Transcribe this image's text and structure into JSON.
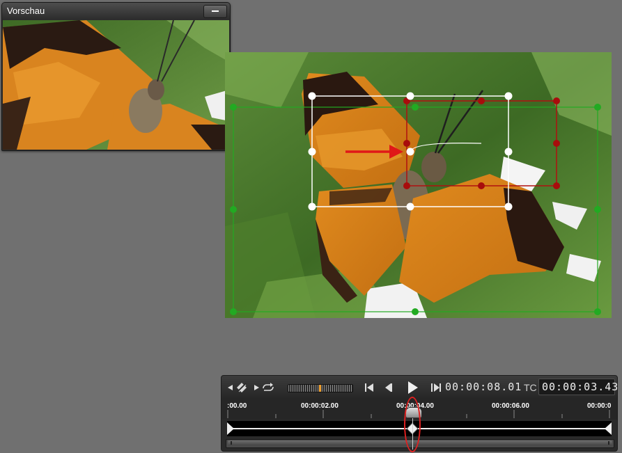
{
  "preview_window": {
    "title": "Vorschau",
    "minimize_icon": "minus-icon"
  },
  "canvas": {
    "image_subject": "butterfly-photo",
    "frames": {
      "start_frame_color": "#ffffff",
      "end_frame_color": "#c01010",
      "outer_frame_color": "#22aa22"
    },
    "motion_arrow_color": "#e01818",
    "arrow_icon": "motion-arrow-icon"
  },
  "timeline": {
    "duration": "00:00:08.01",
    "tc_label": "TC",
    "timecode": "00:00:03.43",
    "ruler_labels": [
      ":00.00",
      "00:00:02.00",
      "00:00:04.00",
      "00:00:06.00",
      "00:00:0"
    ],
    "icons": [
      "prev-frame-icon",
      "keyframe-delete-icon",
      "next-frame-icon",
      "loop-icon",
      "go-to-start-icon",
      "step-back-icon",
      "play-icon",
      "go-to-end-icon"
    ],
    "accent_color": "#f0a030"
  },
  "annotation": {
    "color": "#e02020"
  }
}
